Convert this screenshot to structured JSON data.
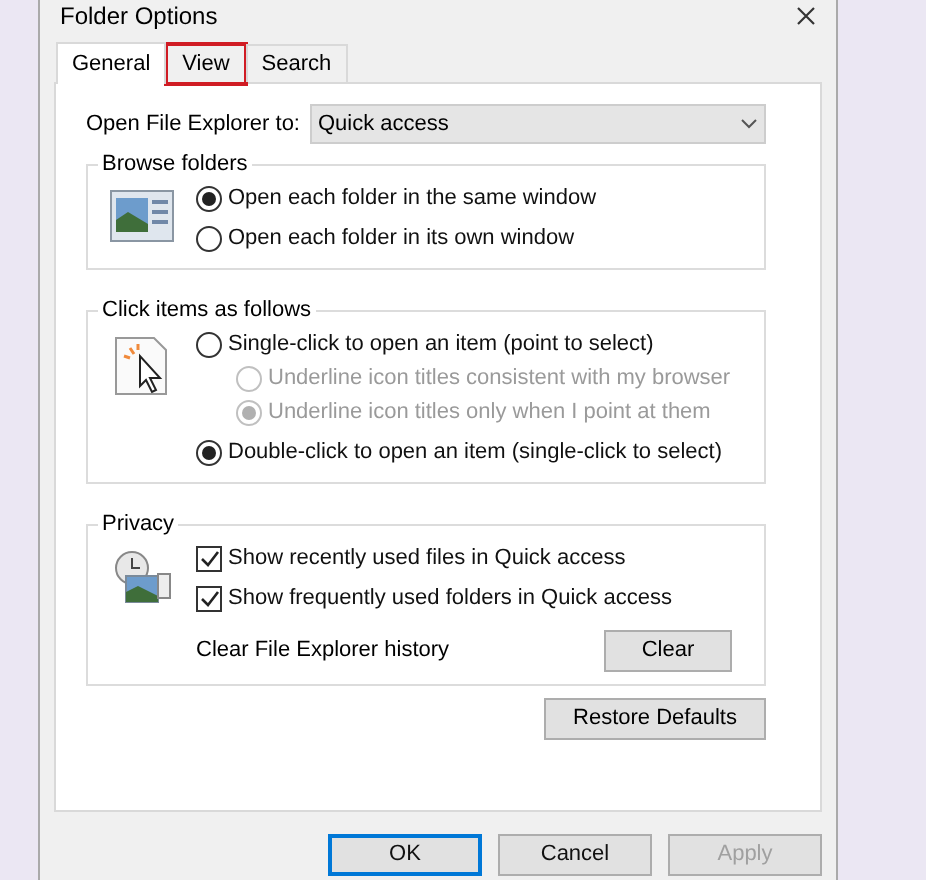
{
  "window": {
    "title": "Folder Options"
  },
  "tabs": [
    {
      "label": "General",
      "selected": true,
      "highlighted": false
    },
    {
      "label": "View",
      "selected": false,
      "highlighted": true
    },
    {
      "label": "Search",
      "selected": false,
      "highlighted": false
    }
  ],
  "open_to": {
    "label": "Open File Explorer to:",
    "value": "Quick access"
  },
  "groups": [
    {
      "kind": "browse",
      "title": "Browse folders",
      "options": [
        {
          "kind": "radio",
          "label": "Open each folder in the same window",
          "checked": true,
          "disabled": false
        },
        {
          "kind": "radio",
          "label": "Open each folder in its own window",
          "checked": false,
          "disabled": false
        }
      ]
    },
    {
      "kind": "click",
      "title": "Click items as follows",
      "options": [
        {
          "kind": "radio",
          "label": "Single-click to open an item (point to select)",
          "checked": false,
          "disabled": false,
          "children": [
            {
              "kind": "radio",
              "label": "Underline icon titles consistent with my browser",
              "checked": false,
              "disabled": true
            },
            {
              "kind": "radio",
              "label": "Underline icon titles only when I point at them",
              "checked": true,
              "disabled": true
            }
          ]
        },
        {
          "kind": "radio",
          "label": "Double-click to open an item (single-click to select)",
          "checked": true,
          "disabled": false
        }
      ]
    },
    {
      "kind": "privacy",
      "title": "Privacy",
      "options": [
        {
          "kind": "checkbox",
          "label": "Show recently used files in Quick access",
          "checked": true,
          "disabled": false
        },
        {
          "kind": "checkbox",
          "label": "Show frequently used folders in Quick access",
          "checked": true,
          "disabled": false
        }
      ],
      "clear": {
        "label": "Clear File Explorer history",
        "button": "Clear"
      }
    }
  ],
  "restore_button": "Restore Defaults",
  "buttons": [
    {
      "label": "OK",
      "default": true,
      "disabled": false
    },
    {
      "label": "Cancel",
      "default": false,
      "disabled": false
    },
    {
      "label": "Apply",
      "default": false,
      "disabled": true
    }
  ]
}
